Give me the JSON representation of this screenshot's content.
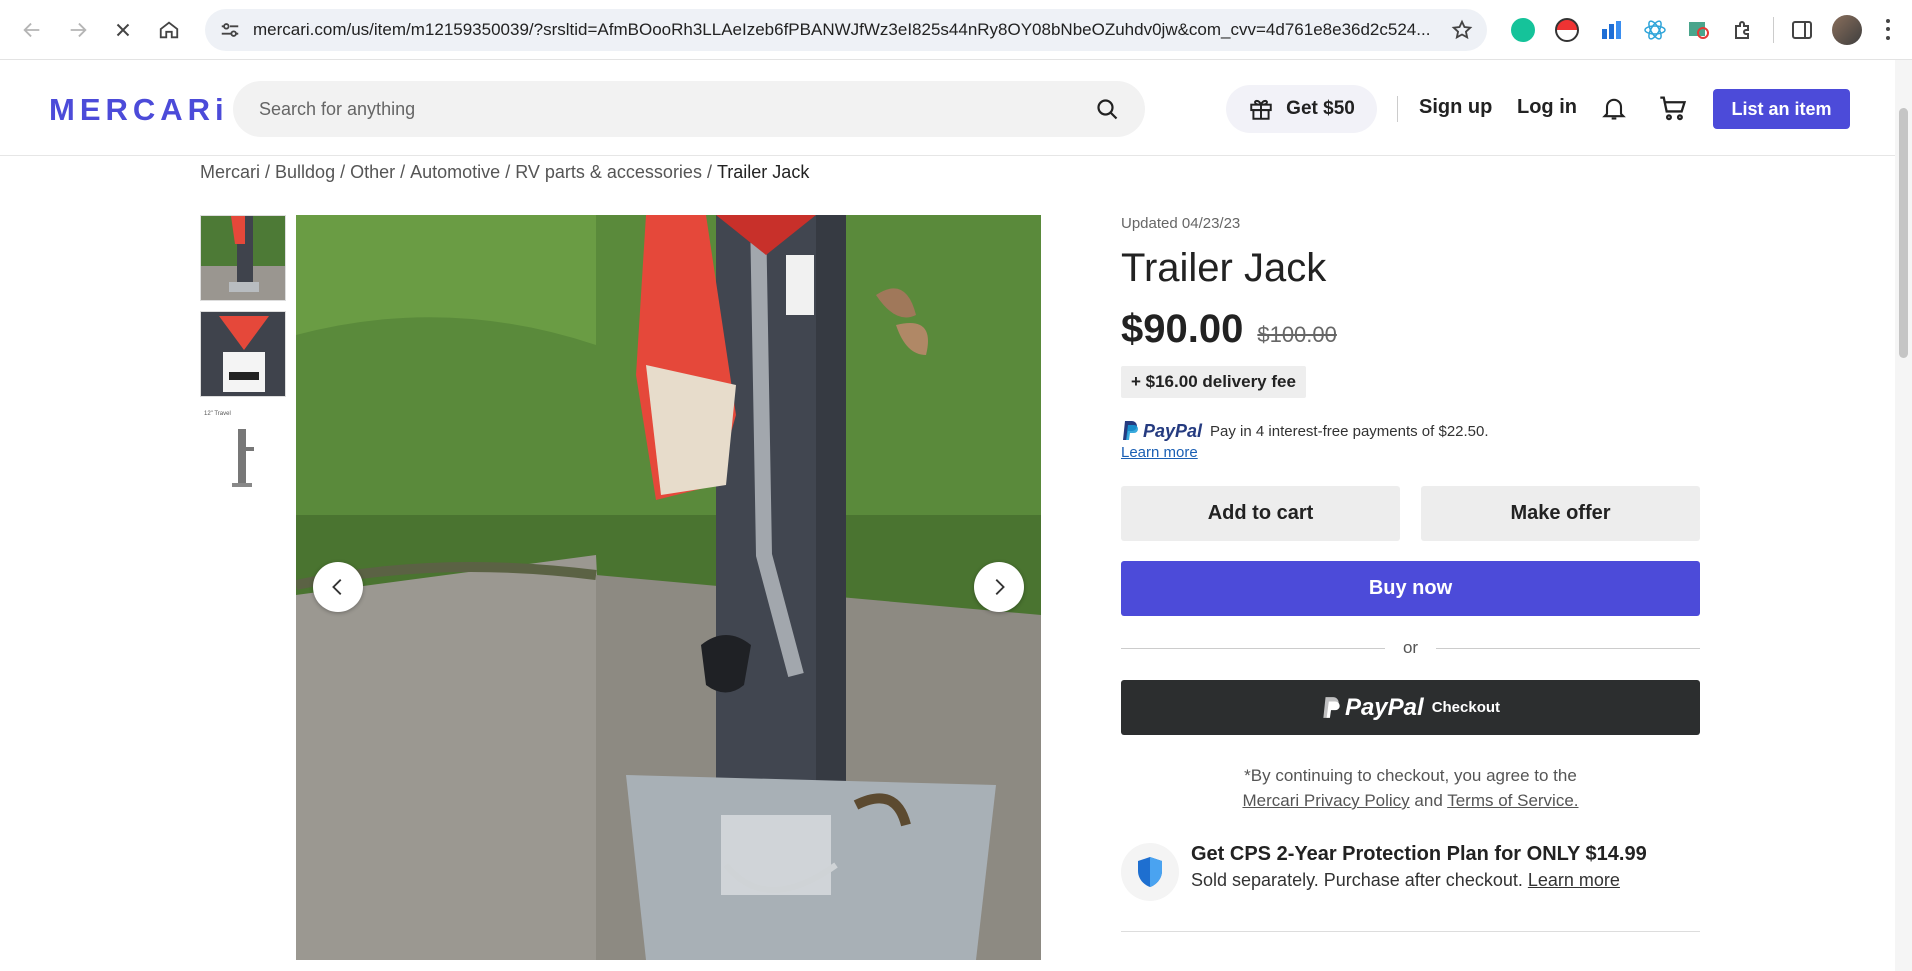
{
  "browser": {
    "url": "mercari.com/us/item/m12159350039/?srsltid=AfmBOooRh3LLAeIzeb6fPBANWJfWz3eI825s44nRy8OY08bNbeOZuhdv0jw&com_cvv=4d761e8e36d2c524..."
  },
  "header": {
    "logo": "MERCARi",
    "search_placeholder": "Search for anything",
    "get50_label": "Get $50",
    "signup_label": "Sign up",
    "login_label": "Log in",
    "list_item_label": "List an item"
  },
  "breadcrumb": {
    "items": [
      "Mercari",
      "Bulldog",
      "Other",
      "Automotive",
      "RV parts & accessories"
    ],
    "separator": " / ",
    "current": "Trailer Jack"
  },
  "product": {
    "updated": "Updated 04/23/23",
    "title": "Trailer Jack",
    "price": "$90.00",
    "original_price": "$100.00",
    "delivery_fee": "+ $16.00 delivery fee",
    "paypal_brand": "PayPal",
    "paypal_text": "Pay in 4 interest-free payments of $22.50.",
    "paypal_learn_more": "Learn more",
    "add_to_cart_label": "Add to cart",
    "make_offer_label": "Make offer",
    "buy_now_label": "Buy now",
    "or_label": "or",
    "paypal_checkout_brand": "PayPal",
    "paypal_checkout_label": "Checkout",
    "disclaimer_prefix": "*By continuing to checkout, you agree to the",
    "privacy_policy": "Mercari Privacy Policy",
    "and_label": "and",
    "terms": "Terms of Service.",
    "cps_title": "Get CPS 2-Year Protection Plan for ONLY $14.99",
    "cps_sub": "Sold separately. Purchase after checkout.",
    "cps_learn_more": "Learn more"
  },
  "thumbnails": [
    {
      "name": "thumb-trailer-jack-photo"
    },
    {
      "name": "thumb-bulldog-label"
    },
    {
      "name": "thumb-product-diagram",
      "caption": "12\" Travel"
    }
  ],
  "colors": {
    "brand": "#4c4bd9",
    "paypal_dark": "#253b80",
    "paypal_light": "#179bd7",
    "checkout_bg": "#2c2e2f"
  }
}
